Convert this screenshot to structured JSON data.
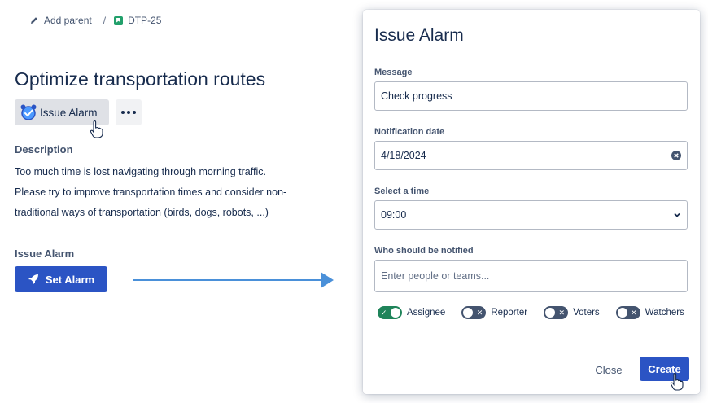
{
  "breadcrumb": {
    "add_parent": "Add parent",
    "separator": "/",
    "issue_key": "DTP-25"
  },
  "issue": {
    "title": "Optimize transportation routes",
    "alarm_button": "Issue Alarm",
    "description_heading": "Description",
    "description_lines": [
      "Too much time is lost navigating through morning traffic.",
      "Please try to improve transportation times and consider non-",
      "traditional ways of transportation (birds, dogs, robots, ...)"
    ],
    "alarm_section_heading": "Issue Alarm",
    "set_alarm_button": "Set Alarm"
  },
  "modal": {
    "title": "Issue Alarm",
    "message_label": "Message",
    "message_value": "Check progress",
    "date_label": "Notification date",
    "date_value": "4/18/2024",
    "time_label": "Select a time",
    "time_value": "09:00",
    "notify_label": "Who should be notified",
    "notify_placeholder": "Enter people or teams...",
    "toggles": [
      {
        "label": "Assignee",
        "on": true
      },
      {
        "label": "Reporter",
        "on": false
      },
      {
        "label": "Voters",
        "on": false
      },
      {
        "label": "Watchers",
        "on": false
      }
    ],
    "close_label": "Close",
    "create_label": "Create"
  },
  "colors": {
    "primary": "#2b54c4",
    "toggle_on": "#1f845a",
    "toggle_off": "#44546f",
    "arrow": "#4a90d9",
    "issue_type": "#22a06b"
  },
  "icons": [
    "pencil-icon",
    "bookmark-icon",
    "alarm-clock-icon",
    "hand-pointer-icon",
    "more-icon",
    "rocket-icon",
    "clear-icon",
    "chevron-down-icon",
    "check-icon",
    "x-icon"
  ]
}
